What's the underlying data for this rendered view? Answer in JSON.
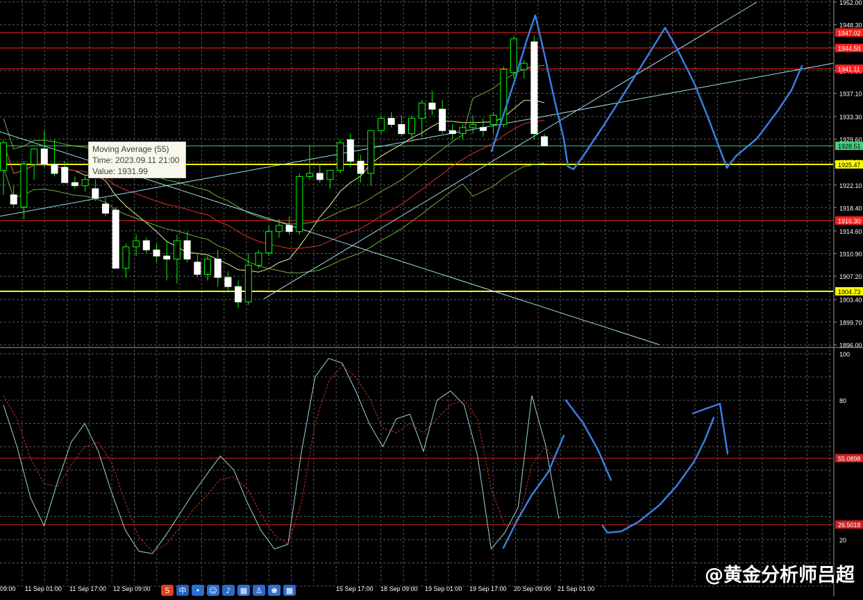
{
  "chart_data": [
    {
      "type": "candlestick",
      "panel": "price",
      "y_axis_ticks": [
        "1952.00",
        "1948.30",
        "1944.50",
        "1940.80",
        "1937.10",
        "1933.30",
        "1929.60",
        "1925.90",
        "1922.10",
        "1918.40",
        "1914.60",
        "1910.90",
        "1907.20",
        "1903.40",
        "1899.70",
        "1896.00"
      ],
      "ylim": [
        1896.0,
        1952.0
      ],
      "horizontal_levels": [
        {
          "value": 1947.02,
          "label": "1947.02",
          "color": "#ff2020"
        },
        {
          "value": 1944.5,
          "label": "1944.50",
          "color": "#ff2020"
        },
        {
          "value": 1941.11,
          "label": "1941.11",
          "color": "#ff2020"
        },
        {
          "value": 1928.51,
          "label": "1928.51",
          "color": "#40d080"
        },
        {
          "value": 1925.47,
          "label": "1925.47",
          "color": "#ffff00"
        },
        {
          "value": 1916.3,
          "label": "1916.30",
          "color": "#ff2020"
        },
        {
          "value": 1904.73,
          "label": "1904.73",
          "color": "#ffff00"
        }
      ],
      "candles": [
        {
          "o": 1924.5,
          "h": 1929.5,
          "l": 1920.5,
          "c": 1929.0
        },
        {
          "o": 1920.5,
          "h": 1922.0,
          "l": 1918.5,
          "c": 1919.0
        },
        {
          "o": 1918.5,
          "h": 1926.0,
          "l": 1916.5,
          "c": 1925.5
        },
        {
          "o": 1925.5,
          "h": 1928.0,
          "l": 1923.0,
          "c": 1928.0
        },
        {
          "o": 1928.0,
          "h": 1931.0,
          "l": 1925.0,
          "c": 1925.5
        },
        {
          "o": 1925.5,
          "h": 1929.5,
          "l": 1923.5,
          "c": 1924.0
        },
        {
          "o": 1925.0,
          "h": 1926.0,
          "l": 1922.5,
          "c": 1922.5
        },
        {
          "o": 1922.5,
          "h": 1923.5,
          "l": 1921.5,
          "c": 1922.0
        },
        {
          "o": 1922.0,
          "h": 1923.5,
          "l": 1921.0,
          "c": 1923.0
        },
        {
          "o": 1921.5,
          "h": 1923.0,
          "l": 1919.5,
          "c": 1920.0
        },
        {
          "o": 1919.0,
          "h": 1920.0,
          "l": 1917.0,
          "c": 1917.5
        },
        {
          "o": 1918.0,
          "h": 1918.5,
          "l": 1908.5,
          "c": 1908.5
        },
        {
          "o": 1908.5,
          "h": 1912.5,
          "l": 1907.0,
          "c": 1912.0
        },
        {
          "o": 1912.0,
          "h": 1914.0,
          "l": 1910.5,
          "c": 1913.0
        },
        {
          "o": 1913.0,
          "h": 1913.5,
          "l": 1911.0,
          "c": 1911.5
        },
        {
          "o": 1911.5,
          "h": 1912.5,
          "l": 1909.5,
          "c": 1910.5
        },
        {
          "o": 1910.5,
          "h": 1913.0,
          "l": 1906.5,
          "c": 1910.0
        },
        {
          "o": 1910.0,
          "h": 1914.0,
          "l": 1906.0,
          "c": 1913.0
        },
        {
          "o": 1913.0,
          "h": 1914.5,
          "l": 1909.5,
          "c": 1910.0
        },
        {
          "o": 1909.5,
          "h": 1911.0,
          "l": 1907.0,
          "c": 1907.5
        },
        {
          "o": 1907.5,
          "h": 1910.5,
          "l": 1906.5,
          "c": 1910.0
        },
        {
          "o": 1910.0,
          "h": 1911.5,
          "l": 1905.5,
          "c": 1907.0
        },
        {
          "o": 1907.0,
          "h": 1908.0,
          "l": 1904.5,
          "c": 1905.5
        },
        {
          "o": 1905.5,
          "h": 1906.5,
          "l": 1902.0,
          "c": 1903.0
        },
        {
          "o": 1903.0,
          "h": 1911.0,
          "l": 1902.5,
          "c": 1909.0
        },
        {
          "o": 1909.0,
          "h": 1911.5,
          "l": 1908.5,
          "c": 1911.0
        },
        {
          "o": 1911.0,
          "h": 1915.5,
          "l": 1910.5,
          "c": 1914.5
        },
        {
          "o": 1914.5,
          "h": 1916.5,
          "l": 1913.5,
          "c": 1915.5
        },
        {
          "o": 1915.5,
          "h": 1917.0,
          "l": 1914.0,
          "c": 1914.5
        },
        {
          "o": 1914.5,
          "h": 1924.0,
          "l": 1914.0,
          "c": 1923.5
        },
        {
          "o": 1923.5,
          "h": 1928.5,
          "l": 1923.0,
          "c": 1924.0
        },
        {
          "o": 1924.0,
          "h": 1925.5,
          "l": 1922.5,
          "c": 1923.0
        },
        {
          "o": 1923.0,
          "h": 1924.5,
          "l": 1921.5,
          "c": 1924.5
        },
        {
          "o": 1924.5,
          "h": 1929.5,
          "l": 1924.0,
          "c": 1929.0
        },
        {
          "o": 1929.5,
          "h": 1930.5,
          "l": 1925.0,
          "c": 1926.0
        },
        {
          "o": 1926.0,
          "h": 1927.0,
          "l": 1922.5,
          "c": 1924.0
        },
        {
          "o": 1924.0,
          "h": 1931.0,
          "l": 1922.0,
          "c": 1931.0
        },
        {
          "o": 1931.0,
          "h": 1933.5,
          "l": 1930.5,
          "c": 1933.0
        },
        {
          "o": 1933.0,
          "h": 1934.0,
          "l": 1931.5,
          "c": 1932.0
        },
        {
          "o": 1932.0,
          "h": 1933.5,
          "l": 1930.0,
          "c": 1930.5
        },
        {
          "o": 1930.5,
          "h": 1933.5,
          "l": 1929.5,
          "c": 1933.0
        },
        {
          "o": 1933.0,
          "h": 1936.0,
          "l": 1930.0,
          "c": 1935.5
        },
        {
          "o": 1935.5,
          "h": 1937.5,
          "l": 1933.5,
          "c": 1934.5
        },
        {
          "o": 1934.5,
          "h": 1936.0,
          "l": 1930.5,
          "c": 1931.0
        },
        {
          "o": 1931.0,
          "h": 1932.0,
          "l": 1929.5,
          "c": 1930.5
        },
        {
          "o": 1930.5,
          "h": 1932.0,
          "l": 1929.5,
          "c": 1931.5
        },
        {
          "o": 1931.5,
          "h": 1933.5,
          "l": 1930.5,
          "c": 1932.0
        },
        {
          "o": 1931.5,
          "h": 1933.0,
          "l": 1930.0,
          "c": 1931.0
        },
        {
          "o": 1932.0,
          "h": 1934.0,
          "l": 1930.5,
          "c": 1933.5
        },
        {
          "o": 1932.0,
          "h": 1941.5,
          "l": 1931.5,
          "c": 1941.0
        },
        {
          "o": 1940.5,
          "h": 1946.5,
          "l": 1939.5,
          "c": 1946.0
        },
        {
          "o": 1941.0,
          "h": 1942.5,
          "l": 1939.5,
          "c": 1942.0
        },
        {
          "o": 1945.5,
          "h": 1946.5,
          "l": 1929.5,
          "c": 1930.5
        },
        {
          "o": 1930.0,
          "h": 1930.5,
          "l": 1928.5,
          "c": 1928.5
        }
      ],
      "moving_average_tooltip": {
        "title": "Moving Average (55)",
        "time": "Time: 2023.09.11 21:00",
        "value": "Value: 1931.99"
      }
    },
    {
      "type": "line",
      "panel": "oscillator",
      "y_axis_ticks": [
        "100",
        "80",
        "20"
      ],
      "ylim": [
        0,
        100
      ],
      "horizontal_levels": [
        {
          "value": 55.0898,
          "label": "55.0898",
          "color": "#d02020"
        },
        {
          "value": 26.5018,
          "label": "26.5018",
          "color": "#d02020"
        }
      ],
      "series": [
        {
          "color": "#9ad8d0",
          "style": "solid",
          "values": [
            78,
            60,
            38,
            26,
            45,
            62,
            70,
            58,
            40,
            24,
            15,
            14,
            22,
            31,
            40,
            48,
            56,
            50,
            36,
            24,
            16,
            18,
            58,
            90,
            98,
            96,
            84,
            70,
            60,
            72,
            74,
            58,
            80,
            84,
            78,
            56,
            16,
            23,
            34,
            82,
            61,
            29
          ]
        },
        {
          "color": "#d03020",
          "style": "dashed",
          "values": [
            82,
            72,
            55,
            44,
            43,
            52,
            60,
            62,
            53,
            36,
            21,
            15,
            18,
            25,
            33,
            39,
            46,
            47,
            42,
            31,
            22,
            18,
            36,
            70,
            88,
            95,
            90,
            81,
            68,
            66,
            70,
            66,
            72,
            78,
            80,
            72,
            42,
            26,
            28,
            52,
            60,
            52
          ]
        }
      ]
    }
  ],
  "x_axis_labels": [
    "09:00",
    "11 Sep 01:00",
    "11 Sep 17:00",
    "12 Sep 09:00",
    "15 Sep 17:00",
    "18 Sep 09:00",
    "19 Sep 01:00",
    "19 Sep 17:00",
    "20 Sep 09:00",
    "21 Sep 01:00"
  ],
  "tooltip": {
    "line1": "Moving Average (55)",
    "line2": "Time: 2023.09.11 21:00",
    "line3": "Value: 1931.99"
  },
  "watermark": "@黄金分析师吕超",
  "colors": {
    "bull": "#ffffff",
    "bear": "#ffffff",
    "wick": "#00ff00",
    "grid": "#5a5a5a",
    "axis_text": "#ffffff",
    "annotation": "#3a7fe0"
  }
}
